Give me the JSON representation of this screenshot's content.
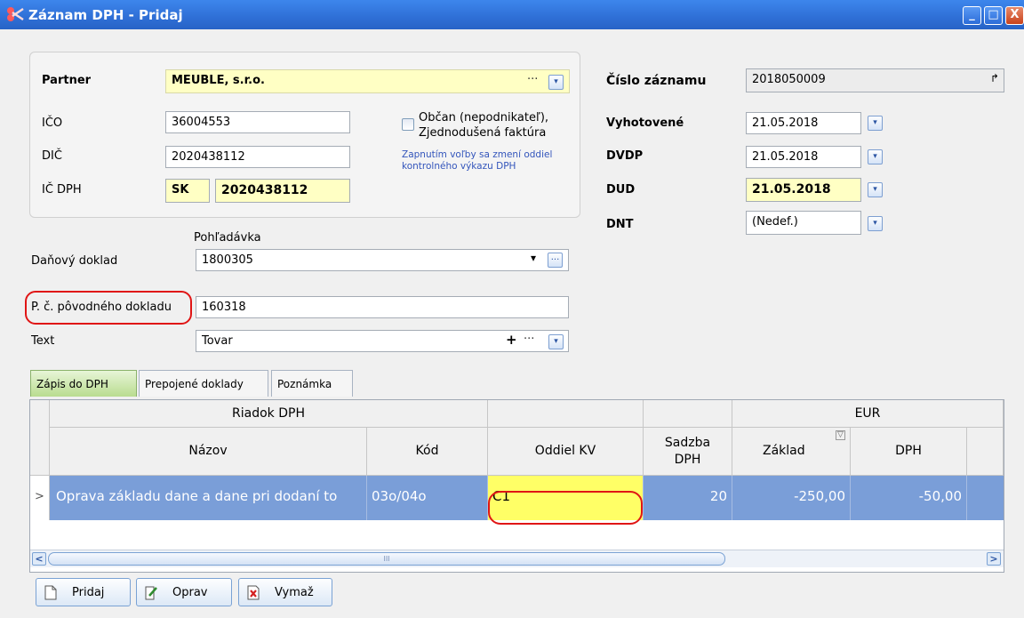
{
  "window": {
    "title": "Záznam DPH - Pridaj",
    "minimize": "_",
    "maximize": "□",
    "close": "X"
  },
  "partner": {
    "label": "Partner",
    "value": "MEUBLE, s.r.o.",
    "dots": "···"
  },
  "ico": {
    "label": "IČO",
    "value": "36004553"
  },
  "dic": {
    "label": "DIČ",
    "value": "2020438112"
  },
  "icdph": {
    "label": "IČ DPH",
    "prefix": "SK",
    "value": "2020438112"
  },
  "obcan": {
    "label_line1": "Občan (nepodnikateľ),",
    "label_line2": "Zjednodušená faktúra",
    "hint_line1": "Zapnutím voľby sa zmení oddiel",
    "hint_line2": "kontrolného výkazu DPH"
  },
  "cislo": {
    "label": "Číslo záznamu",
    "value": "2018050009",
    "icon": "↱"
  },
  "vyhotovene": {
    "label": "Vyhotovené",
    "value": "21.05.2018"
  },
  "dvdp": {
    "label": "DVDP",
    "value": "21.05.2018"
  },
  "dud": {
    "label": "DUD",
    "value": "21.05.2018"
  },
  "dnt": {
    "label": "DNT",
    "value": "(Nedef.)"
  },
  "danovy": {
    "label": "Daňový doklad",
    "sublabel": "Pohľadávka",
    "value": "1800305",
    "arrow": "▾",
    "dots": "···"
  },
  "povodny": {
    "label": "P. č. pôvodného dokladu",
    "value": "160318"
  },
  "text": {
    "label": "Text",
    "value": "Tovar",
    "plus": "+",
    "dots": "···"
  },
  "tabs": [
    {
      "label": "Zápis do DPH"
    },
    {
      "label": "Prepojené doklady"
    },
    {
      "label": "Poznámka"
    }
  ],
  "grid": {
    "band_riadok": "Riadok DPH",
    "band_eur": "EUR",
    "col_nazov": "Názov",
    "col_kod": "Kód",
    "col_oddiel": "Oddiel KV",
    "col_sadzba_1": "Sadzba",
    "col_sadzba_2": "DPH",
    "col_zaklad": "Základ",
    "col_dph": "DPH",
    "filter_icon": "▽",
    "row_indicator": ">",
    "rows": [
      {
        "nazov": "Oprava základu dane a dane pri dodaní to",
        "kod": "03o/04o",
        "oddiel": "C1",
        "sadzba": "20",
        "zaklad": "-250,00",
        "dph": "-50,00"
      }
    ],
    "scroll_left": "<",
    "scroll_right": ">",
    "scroll_grip": "III"
  },
  "buttons": {
    "pridaj": "Pridaj",
    "oprav": "Oprav",
    "vymaz": "Vymaž"
  }
}
